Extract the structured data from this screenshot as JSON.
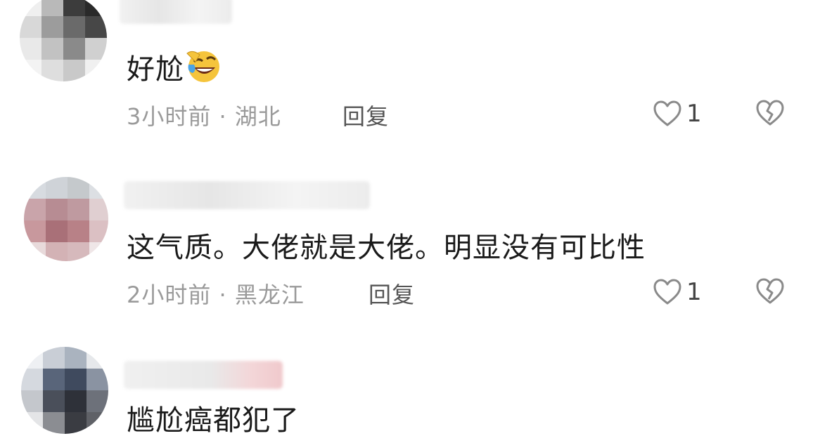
{
  "comments": [
    {
      "text": "好尬",
      "emoji": "laughing-tears-emoji",
      "time": "3小时前",
      "separator": "·",
      "location": "湖北",
      "reply_label": "回复",
      "like_count": "1"
    },
    {
      "text": "这气质。大佬就是大佬。明显没有可比性",
      "time": "2小时前",
      "separator": "·",
      "location": "黑龙江",
      "reply_label": "回复",
      "like_count": "1"
    },
    {
      "text": "尴尬癌都犯了"
    }
  ],
  "icons": {
    "like": "heart-outline-icon",
    "dislike": "broken-heart-icon"
  },
  "colors": {
    "text_primary": "#1a1a1a",
    "text_secondary": "#9a9a9a",
    "reply": "#555555",
    "icon": "#8a8a8a"
  }
}
